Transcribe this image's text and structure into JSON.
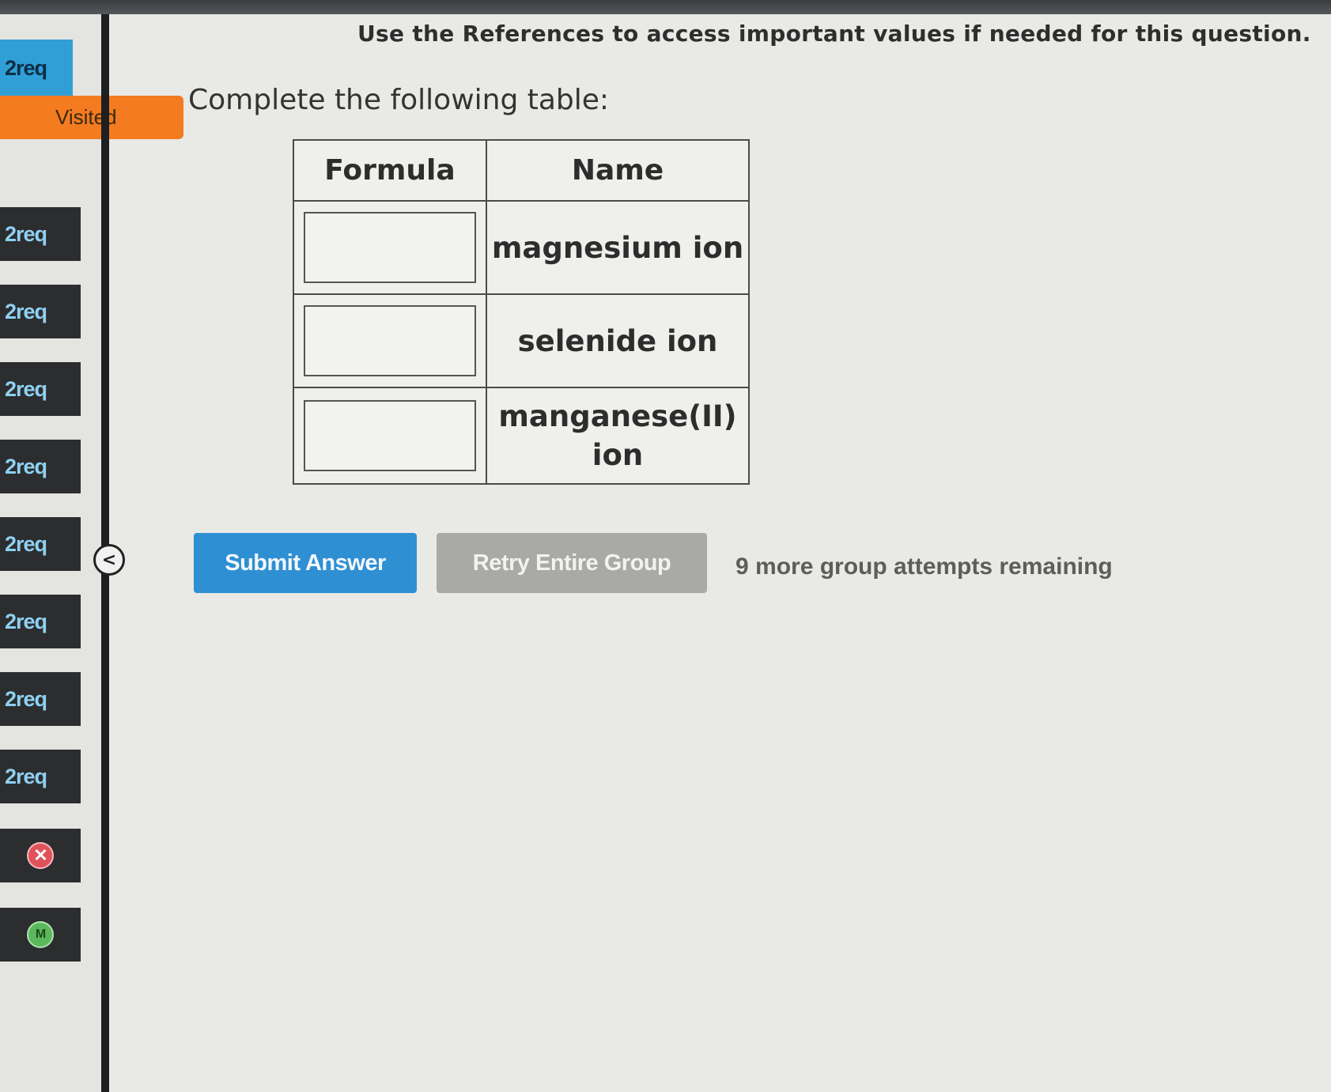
{
  "sidebar": {
    "active_tab": "2req",
    "visited_label": "Visited",
    "tabs": [
      "2req",
      "2req",
      "2req",
      "2req",
      "2req",
      "2req",
      "2req",
      "2req"
    ],
    "collapse_glyph": "<",
    "icons": [
      "x-circle-icon",
      "m-circle-icon"
    ],
    "m_icon_glyph": "M",
    "x_icon_glyph": "✕"
  },
  "question": {
    "instructions": "Use the References to access important values if needed for this question.",
    "prompt": "Complete the following table:",
    "table": {
      "headers": [
        "Formula",
        "Name"
      ],
      "rows": [
        {
          "formula": "",
          "name": "magnesium ion"
        },
        {
          "formula": "",
          "name": "selenide ion"
        },
        {
          "formula": "",
          "name_line1": "manganese(II)",
          "name_line2": "ion"
        }
      ]
    }
  },
  "actions": {
    "submit_label": "Submit Answer",
    "retry_label": "Retry Entire Group",
    "attempts_text": "9 more group attempts remaining"
  },
  "colors": {
    "active_tab": "#2f9fd6",
    "visited": "#f47b20",
    "tab_bg": "#2b2d2f",
    "tab_text": "#8fd0f0",
    "submit": "#2f8fd3",
    "retry": "#a9a9a7"
  }
}
